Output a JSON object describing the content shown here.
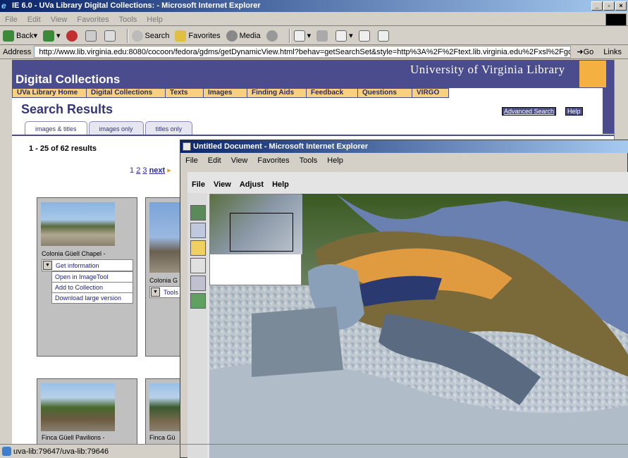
{
  "window": {
    "title": "IE 6.0 - UVa Library Digital Collections: - Microsoft Internet Explorer"
  },
  "menu": [
    "File",
    "Edit",
    "View",
    "Favorites",
    "Tools",
    "Help"
  ],
  "toolbar": {
    "back": "Back",
    "search": "Search",
    "favorites": "Favorites",
    "media": "Media"
  },
  "address": {
    "label": "Address",
    "url": "http://www.lib.virginia.edu:8080/cocoon/fedora/gdms/getDynamicView.html?behav=getSearchSet&style=http%3A%2F%2Ftext.lib.virginia.edu%2Fxsl%2Fgdms%2Fgdms.x",
    "go": "Go",
    "links": "Links"
  },
  "site": {
    "banner_title": "Digital Collections",
    "library_name": "University of Virginia Library",
    "nav": [
      "UVa Library Home",
      "Digital Collections",
      "Texts",
      "Images",
      "Finding Aids",
      "Feedback",
      "Questions",
      "VIRGO"
    ],
    "page_title": "Search Results",
    "advanced_search": "Advanced Search",
    "help": "Help",
    "tabs": [
      "images & titles",
      "images only",
      "titles only"
    ],
    "result_count": "1 - 25 of 62 results",
    "pager": {
      "pages": [
        "1",
        "2",
        "3"
      ],
      "next": "next"
    },
    "cards": [
      {
        "caption": "Colonia Güell Chapel -"
      },
      {
        "caption": "Colonia G"
      },
      {
        "caption": "Finca Güell Pavilions -"
      },
      {
        "caption": "Finca Gü"
      }
    ],
    "card_menu": [
      "Get information",
      "Open in ImageTool",
      "Add to Collection",
      "Download large version"
    ],
    "tools_label": "Tools"
  },
  "popup": {
    "title": "Untitled Document - Microsoft Internet Explorer",
    "menu": [
      "File",
      "Edit",
      "View",
      "Favorites",
      "Tools",
      "Help"
    ],
    "app_menu": [
      "File",
      "View",
      "Adjust",
      "Help"
    ]
  },
  "status": {
    "text": "uva-lib:79647/uva-lib:79646"
  }
}
